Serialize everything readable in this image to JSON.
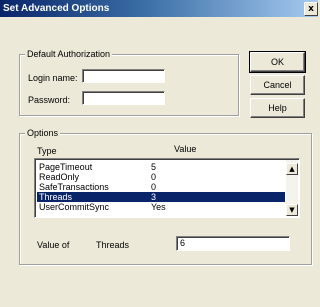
{
  "window": {
    "title": "Set Advanced Options",
    "close_glyph": "x"
  },
  "default_authorization": {
    "legend": "Default Authorization",
    "login_name_label": "Login name:",
    "login_name_value": "",
    "password_label": "Password:",
    "password_value": ""
  },
  "buttons": {
    "ok": "OK",
    "cancel": "Cancel",
    "help": "Help"
  },
  "options": {
    "legend": "Options",
    "col_type": "Type",
    "col_value": "Value",
    "rows": [
      {
        "type": "PageTimeout",
        "value": "5"
      },
      {
        "type": "ReadOnly",
        "value": "0"
      },
      {
        "type": "SafeTransactions",
        "value": "0"
      },
      {
        "type": "Threads",
        "value": "3",
        "selected": true
      },
      {
        "type": "UserCommitSync",
        "value": "Yes"
      }
    ],
    "value_of_label": "Value of",
    "value_of_name": "Threads",
    "value_of_input": "6"
  },
  "icons": {
    "scroll_up": "scroll-up-arrow-icon",
    "scroll_down": "scroll-down-arrow-icon"
  }
}
